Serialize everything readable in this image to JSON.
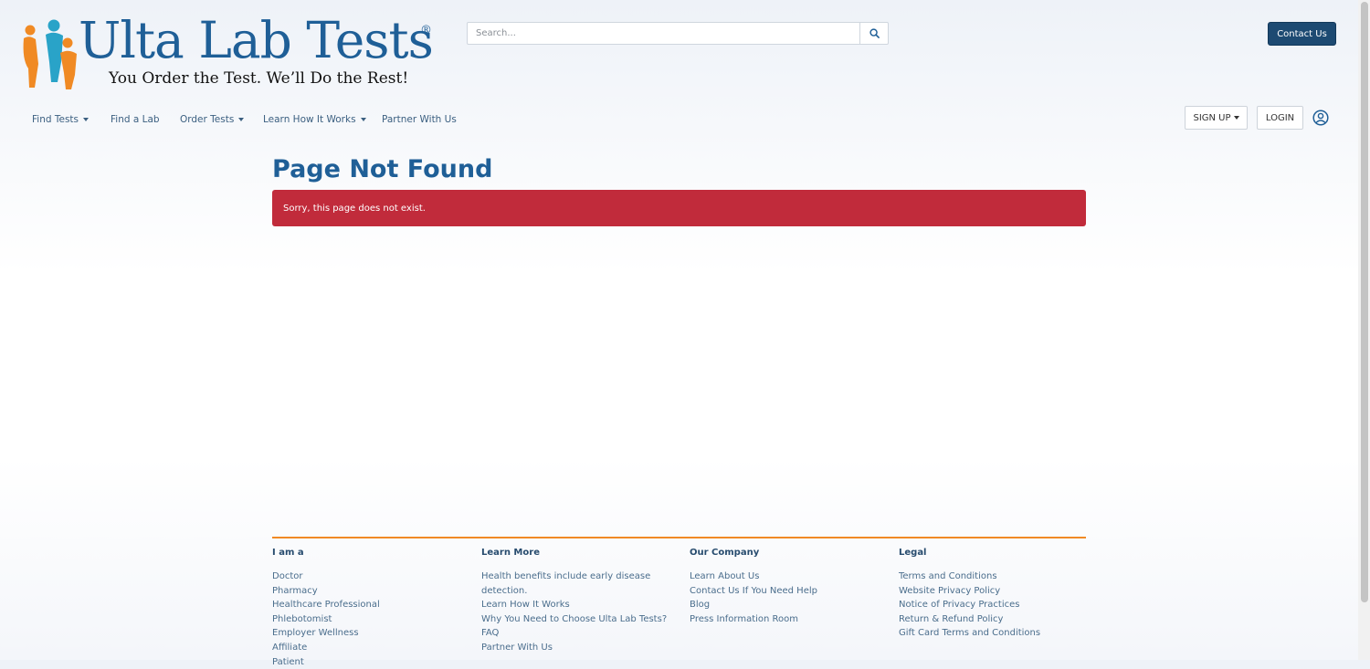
{
  "brand": {
    "title": "Ulta Lab Tests",
    "registered": "®",
    "tagline": "You Order the Test. We’ll Do the Rest!",
    "colors": {
      "primary": "#1f5f97",
      "orange": "#f08a24",
      "teal": "#29a3c8"
    }
  },
  "search": {
    "placeholder": "Search...",
    "icon": "search-icon"
  },
  "header": {
    "contact_label": "Contact Us"
  },
  "nav": {
    "items": [
      {
        "label": "Find Tests",
        "dropdown": true
      },
      {
        "label": "Find a Lab",
        "dropdown": false
      },
      {
        "label": "Order Tests",
        "dropdown": true
      },
      {
        "label": "Learn How It Works",
        "dropdown": true
      },
      {
        "label": "Partner With Us",
        "dropdown": false
      }
    ],
    "signup_label": "SIGN UP",
    "login_label": "LOGIN",
    "user_icon": "user-circle-icon"
  },
  "main": {
    "title": "Page Not Found",
    "alert": "Sorry, this page does not exist.",
    "alert_color": "#c12b3b"
  },
  "footer": {
    "columns": [
      {
        "heading": "I am a",
        "links": [
          "Doctor",
          "Pharmacy",
          "Healthcare Professional",
          "Phlebotomist",
          "Employer Wellness",
          "Affiliate",
          "Patient"
        ]
      },
      {
        "heading": "Learn More",
        "links": [
          "Health benefits include early disease detection.",
          "Learn How It Works",
          "Why You Need to Choose Ulta Lab Tests?",
          "FAQ",
          "Partner With Us"
        ]
      },
      {
        "heading": "Our Company",
        "links": [
          "Learn About Us",
          "Contact Us If You Need Help",
          "Blog",
          "Press Information Room"
        ]
      },
      {
        "heading": "Legal",
        "links": [
          "Terms and Conditions",
          "Website Privacy Policy",
          "Notice of Privacy Practices",
          "Return & Refund Policy",
          "Gift Card Terms and Conditions"
        ]
      }
    ]
  }
}
